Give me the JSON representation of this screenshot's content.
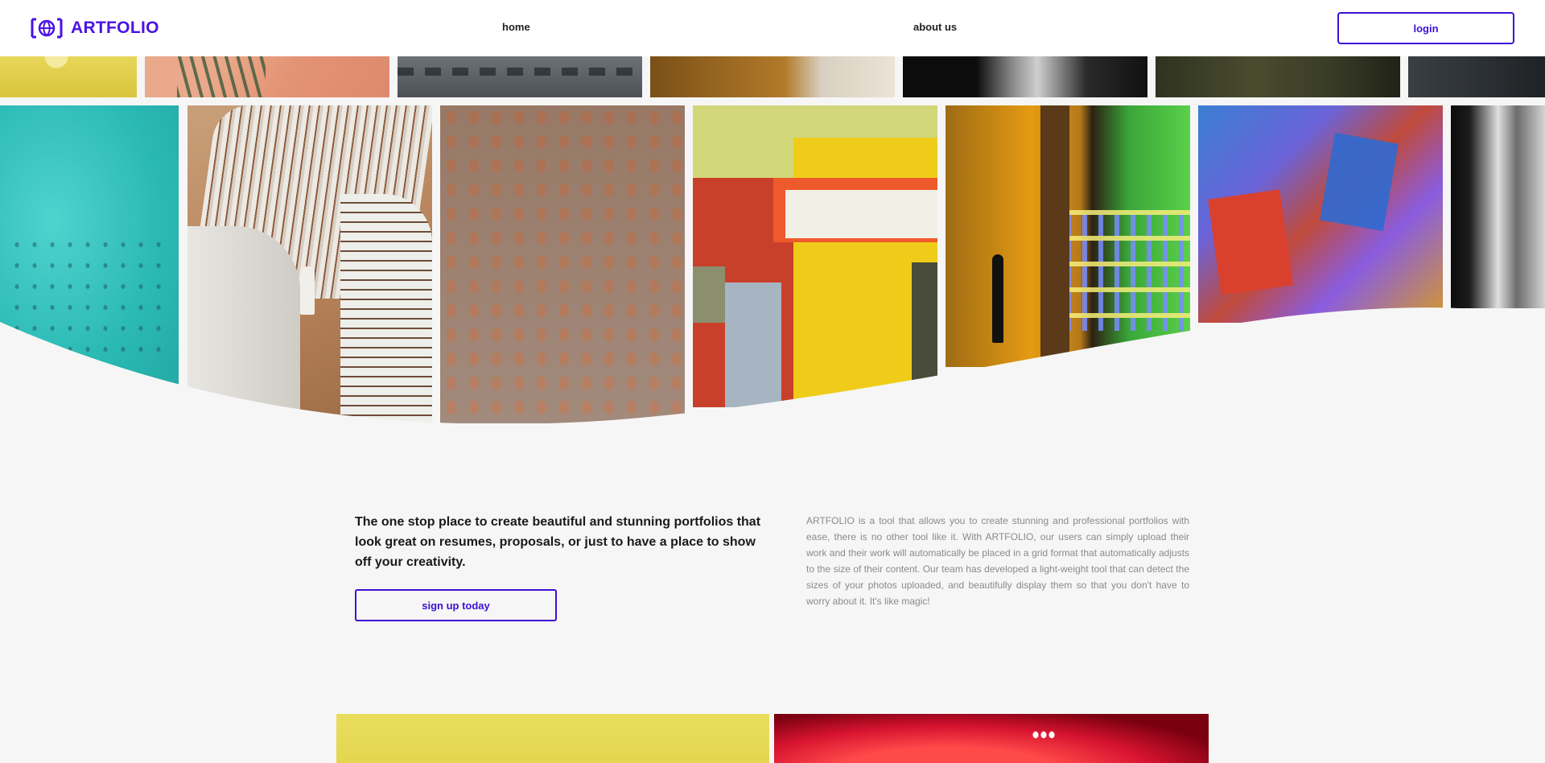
{
  "header": {
    "brand": "ARTFOLIO",
    "nav": [
      {
        "label": "home"
      },
      {
        "label": "about us"
      }
    ],
    "login_label": "login"
  },
  "hero": {
    "headline": "The one stop place to create beautiful and stunning portfolios that look great on resumes, proposals, or just to have a place to show off your creativity.",
    "cta_label": "sign up today",
    "about": "ARTFOLIO is a tool that allows you to create stunning and professional portfolios with ease, there is no other tool like it. With ARTFOLIO, our users can simply upload their work and their work will automatically be placed in a grid format that automatically adjusts to the size of their content. Our team has developed a light-weight tool that can detect the sizes of your photos uploaded, and beautifully display them so that you don't have to worry about it. It's like magic!"
  },
  "colors": {
    "brand": "#4a12e6",
    "accent_border": "#3d10d6",
    "page_background": "#f6f6f6",
    "muted_text": "#8a8a8a"
  },
  "icons": {
    "logo": "frame-globe-icon"
  }
}
